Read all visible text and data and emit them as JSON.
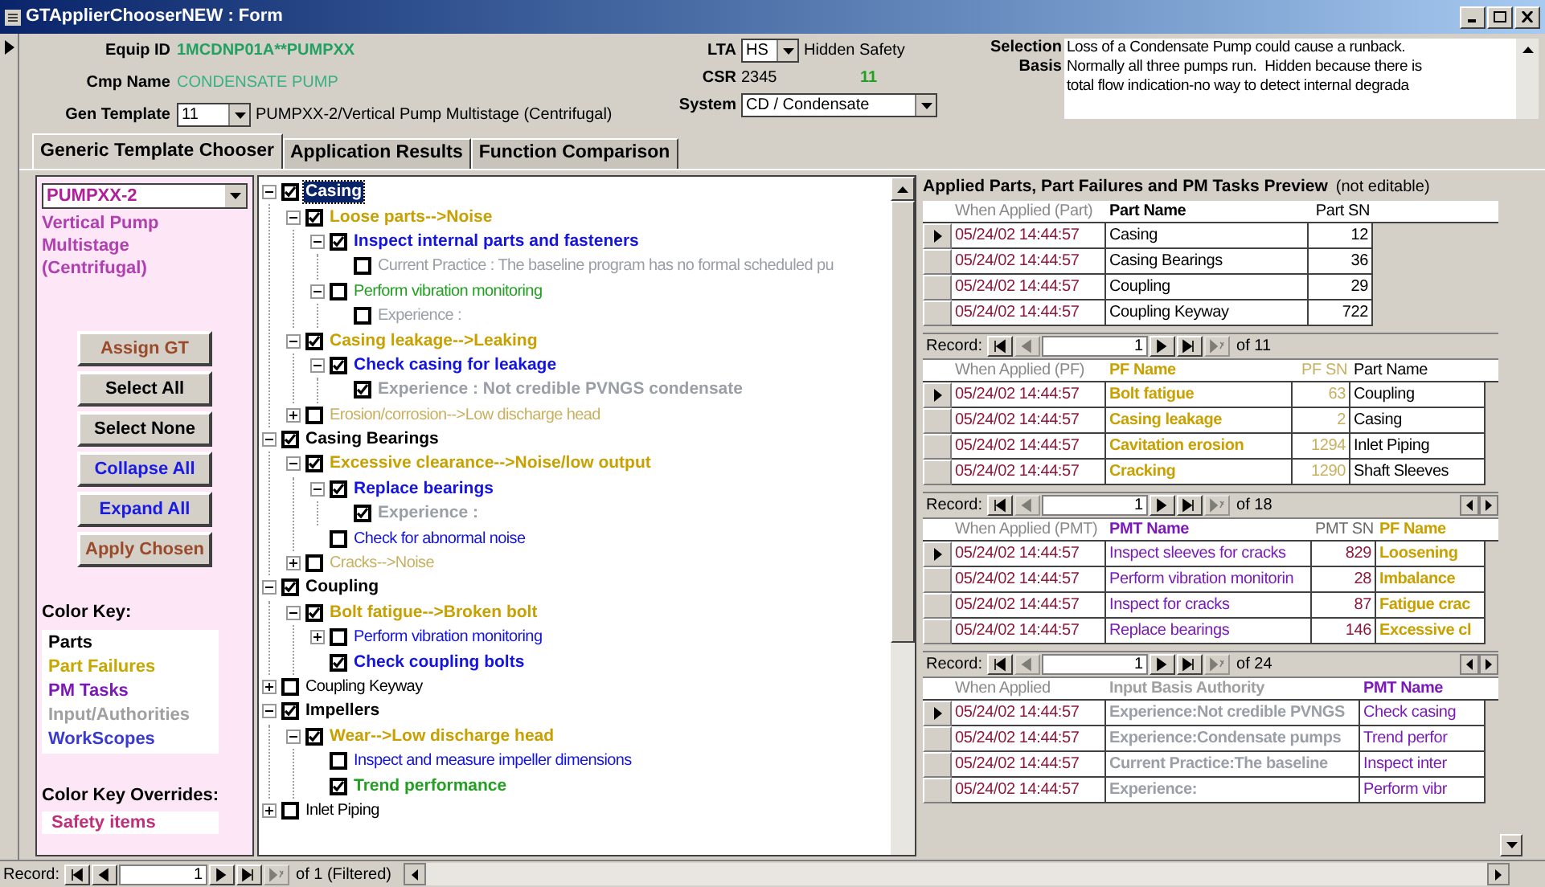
{
  "window": {
    "title": "GTApplierChooserNEW : Form"
  },
  "header": {
    "equip_id": {
      "label": "Equip ID",
      "value": "1MCDNP01A**PUMPXX"
    },
    "cmp_name": {
      "label": "Cmp Name",
      "value": "CONDENSATE PUMP"
    },
    "gen_template": {
      "label": "Gen Template",
      "value": "11",
      "description": "PUMPXX-2/Vertical Pump Multistage (Centrifugal)"
    },
    "lta": {
      "label": "LTA",
      "value": "HS",
      "description": "Hidden Safety"
    },
    "csr": {
      "label": "CSR",
      "value": "2345",
      "count": "11"
    },
    "system": {
      "label": "System",
      "value": "CD / Condensate"
    },
    "selection_label": "Selection",
    "basis_label": "Basis",
    "basis_lines": [
      "Loss of a Condensate Pump could cause a runback.",
      "Normally all three pumps run.  Hidden because there is",
      "total flow indication-no way to detect internal degrada"
    ]
  },
  "tabs": [
    {
      "label": "Generic Template Chooser",
      "selected": true
    },
    {
      "label": "Application Results",
      "selected": false
    },
    {
      "label": "Function Comparison",
      "selected": false
    }
  ],
  "left_panel": {
    "template": "PUMPXX-2",
    "description": "Vertical Pump Multistage (Centrifugal)",
    "buttons": [
      {
        "label": "Assign GT",
        "color": "#9a4a2a"
      },
      {
        "label": "Select All",
        "color": "#000000"
      },
      {
        "label": "Select None",
        "color": "#000000"
      },
      {
        "label": "Collapse All",
        "color": "#1a1ae6"
      },
      {
        "label": "Expand All",
        "color": "#1a1ae6"
      },
      {
        "label": "Apply Chosen",
        "color": "#9a4a2a"
      }
    ],
    "color_key_title": "Color Key:",
    "color_key": [
      {
        "label": "Parts",
        "color": "#000000"
      },
      {
        "label": "Part Failures",
        "color": "#c8a800"
      },
      {
        "label": "PM Tasks",
        "color": "#7a1ab8"
      },
      {
        "label": "Input/Authorities",
        "color": "#a0a0a0"
      },
      {
        "label": "WorkScopes",
        "color": "#3a3ad0"
      }
    ],
    "overrides_title": "Color Key Overrides:",
    "overrides": [
      {
        "label": "Safety items",
        "color": "#c0307a"
      }
    ]
  },
  "tree": [
    {
      "text": "Casing",
      "bold": true,
      "checked": true,
      "selected": true,
      "expanded": true,
      "children": [
        {
          "text": "Loose parts-->Noise",
          "color": "#c8a000",
          "bold": true,
          "checked": true,
          "selected": false,
          "expanded": true,
          "children": [
            {
              "text": "Inspect internal parts and fasteners",
              "color": "#1414e0",
              "bold": true,
              "checked": true,
              "selected": false,
              "expanded": true,
              "children": [
                {
                  "text": "Current Practice : The baseline program has no formal scheduled pu",
                  "color": "#9a9ea6",
                  "bold": false,
                  "checked": false,
                  "selected": false
                }
              ]
            },
            {
              "text": "Perform vibration monitoring",
              "color": "#22a022",
              "bold": false,
              "checked": false,
              "selected": false,
              "expanded": true,
              "children": [
                {
                  "text": "Experience :",
                  "color": "#9a9ea6",
                  "bold": false,
                  "checked": false,
                  "selected": false
                }
              ]
            }
          ]
        },
        {
          "text": "Casing leakage-->Leaking",
          "color": "#c8a000",
          "bold": true,
          "checked": true,
          "selected": false,
          "expanded": true,
          "children": [
            {
              "text": "Check casing for leakage",
              "color": "#1414e0",
              "bold": true,
              "checked": true,
              "selected": false,
              "expanded": true,
              "children": [
                {
                  "text": "Experience : Not credible PVNGS condensate",
                  "color": "#9a9ea6",
                  "bold": true,
                  "checked": true,
                  "selected": false
                }
              ]
            }
          ]
        },
        {
          "text": "Erosion/corrosion-->Low discharge head",
          "color": "#c8b060",
          "bold": false,
          "checked": false,
          "selected": false,
          "expanded": false
        }
      ]
    },
    {
      "text": "Casing Bearings",
      "color": "#000000",
      "bold": true,
      "checked": true,
      "selected": false,
      "expanded": true,
      "children": [
        {
          "text": "Excessive clearance-->Noise/low output",
          "color": "#c8a000",
          "bold": true,
          "checked": true,
          "selected": false,
          "expanded": true,
          "children": [
            {
              "text": "Replace bearings",
              "color": "#1414e0",
              "bold": true,
              "checked": true,
              "selected": false,
              "expanded": true,
              "children": [
                {
                  "text": "Experience :",
                  "color": "#9a9ea6",
                  "bold": true,
                  "checked": true,
                  "selected": false
                }
              ]
            },
            {
              "text": "Check for abnormal noise",
              "color": "#1414e0",
              "bold": false,
              "checked": false,
              "selected": false
            }
          ]
        },
        {
          "text": "Cracks-->Noise",
          "color": "#c8b060",
          "bold": false,
          "checked": false,
          "selected": false,
          "expanded": false
        }
      ]
    },
    {
      "text": "Coupling",
      "color": "#000000",
      "bold": true,
      "checked": true,
      "selected": false,
      "expanded": true,
      "children": [
        {
          "text": "Bolt fatigue-->Broken bolt",
          "color": "#c8a000",
          "bold": true,
          "checked": true,
          "selected": false,
          "expanded": true,
          "children": [
            {
              "text": "Perform vibration monitoring",
              "color": "#1414e0",
              "bold": false,
              "checked": false,
              "selected": false,
              "expanded": false
            },
            {
              "text": "Check coupling bolts",
              "color": "#1414e0",
              "bold": true,
              "checked": true,
              "selected": false
            }
          ]
        }
      ]
    },
    {
      "text": "Coupling Keyway",
      "color": "#000000",
      "bold": false,
      "checked": false,
      "selected": false,
      "expanded": false
    },
    {
      "text": "Impellers",
      "color": "#000000",
      "bold": true,
      "checked": true,
      "selected": false,
      "expanded": true,
      "children": [
        {
          "text": "Wear-->Low discharge head",
          "color": "#c8a000",
          "bold": true,
          "checked": true,
          "selected": false,
          "expanded": true,
          "children": [
            {
              "text": "Inspect and measure impeller dimensions",
              "color": "#1414e0",
              "bold": false,
              "checked": false,
              "selected": false
            },
            {
              "text": "Trend performance",
              "color": "#22a022",
              "bold": true,
              "checked": true,
              "selected": false
            }
          ]
        }
      ]
    },
    {
      "text": "Inlet Piping",
      "color": "#000000",
      "bold": false,
      "checked": false,
      "selected": false,
      "expanded": false
    }
  ],
  "preview": {
    "title": "Applied Parts, Part Failures and PM Tasks Preview",
    "note": "(not editable)",
    "grids": [
      {
        "columns": [
          {
            "label": "When Applied (Part)",
            "kind": "time"
          },
          {
            "label": "Part Name",
            "kind": "part_key"
          },
          {
            "label": "Part SN",
            "kind": "sn"
          }
        ],
        "rows": [
          {
            "current": true,
            "cells": [
              "05/24/02 14:44:57",
              "Casing",
              "12"
            ]
          },
          {
            "current": false,
            "cells": [
              "05/24/02 14:44:57",
              "Casing Bearings",
              "36"
            ]
          },
          {
            "current": false,
            "cells": [
              "05/24/02 14:44:57",
              "Coupling",
              "29"
            ]
          },
          {
            "current": false,
            "cells": [
              "05/24/02 14:44:57",
              "Coupling Keyway",
              "722"
            ]
          }
        ],
        "record": {
          "label": "Record:",
          "value": "1",
          "total": "of 11"
        }
      },
      {
        "columns": [
          {
            "label": "When Applied (PF)",
            "kind": "time"
          },
          {
            "label": "PF Name",
            "kind": "failure"
          },
          {
            "label": "PF SN",
            "kind": "failure_sn"
          },
          {
            "label": "Part Name",
            "kind": "part"
          }
        ],
        "rows": [
          {
            "current": true,
            "cells": [
              "05/24/02 14:44:57",
              "Bolt fatigue",
              "63",
              "Coupling"
            ]
          },
          {
            "current": false,
            "cells": [
              "05/24/02 14:44:57",
              "Casing leakage",
              "2",
              "Casing"
            ]
          },
          {
            "current": false,
            "cells": [
              "05/24/02 14:44:57",
              "Cavitation erosion",
              "1294",
              "Inlet Piping"
            ]
          },
          {
            "current": false,
            "cells": [
              "05/24/02 14:44:57",
              "Cracking",
              "1290",
              "Shaft Sleeves"
            ]
          }
        ],
        "record": {
          "label": "Record:",
          "value": "1",
          "total": "of 18"
        }
      },
      {
        "columns": [
          {
            "label": "When Applied (PMT)",
            "kind": "time"
          },
          {
            "label": "PMT Name",
            "kind": "task"
          },
          {
            "label": "PMT SN",
            "kind": "task_sn"
          },
          {
            "label": "PF Name",
            "kind": "failure"
          }
        ],
        "rows": [
          {
            "current": true,
            "cells": [
              "05/24/02 14:44:57",
              "Inspect sleeves for cracks",
              "829",
              "Loosening"
            ]
          },
          {
            "current": false,
            "cells": [
              "05/24/02 14:44:57",
              "Perform vibration monitorin",
              "28",
              "Imbalance"
            ]
          },
          {
            "current": false,
            "cells": [
              "05/24/02 14:44:57",
              "Inspect for cracks",
              "87",
              "Fatigue crac"
            ]
          },
          {
            "current": false,
            "cells": [
              "05/24/02 14:44:57",
              "Replace bearings",
              "146",
              "Excessive cl"
            ]
          }
        ],
        "record": {
          "label": "Record:",
          "value": "1",
          "total": "of 24"
        }
      },
      {
        "columns": [
          {
            "label": "When Applied",
            "kind": "time"
          },
          {
            "label": "Input Basis Authority",
            "kind": "input"
          },
          {
            "label": "PMT Name",
            "kind": "task"
          }
        ],
        "rows": [
          {
            "current": true,
            "cells": [
              "05/24/02 14:44:57",
              "Experience:Not credible PVNGS",
              "Check casing"
            ]
          },
          {
            "current": false,
            "cells": [
              "05/24/02 14:44:57",
              "Experience:Condensate pumps",
              "Trend perfor"
            ]
          },
          {
            "current": false,
            "cells": [
              "05/24/02 14:44:57",
              "Current Practice:The baseline",
              "Inspect inter"
            ]
          },
          {
            "current": false,
            "cells": [
              "05/24/02 14:44:57",
              "Experience:",
              "Perform vibr"
            ]
          }
        ]
      }
    ]
  },
  "record_bar": {
    "label": "Record:",
    "value": "1",
    "total": "of 1 (Filtered)"
  }
}
